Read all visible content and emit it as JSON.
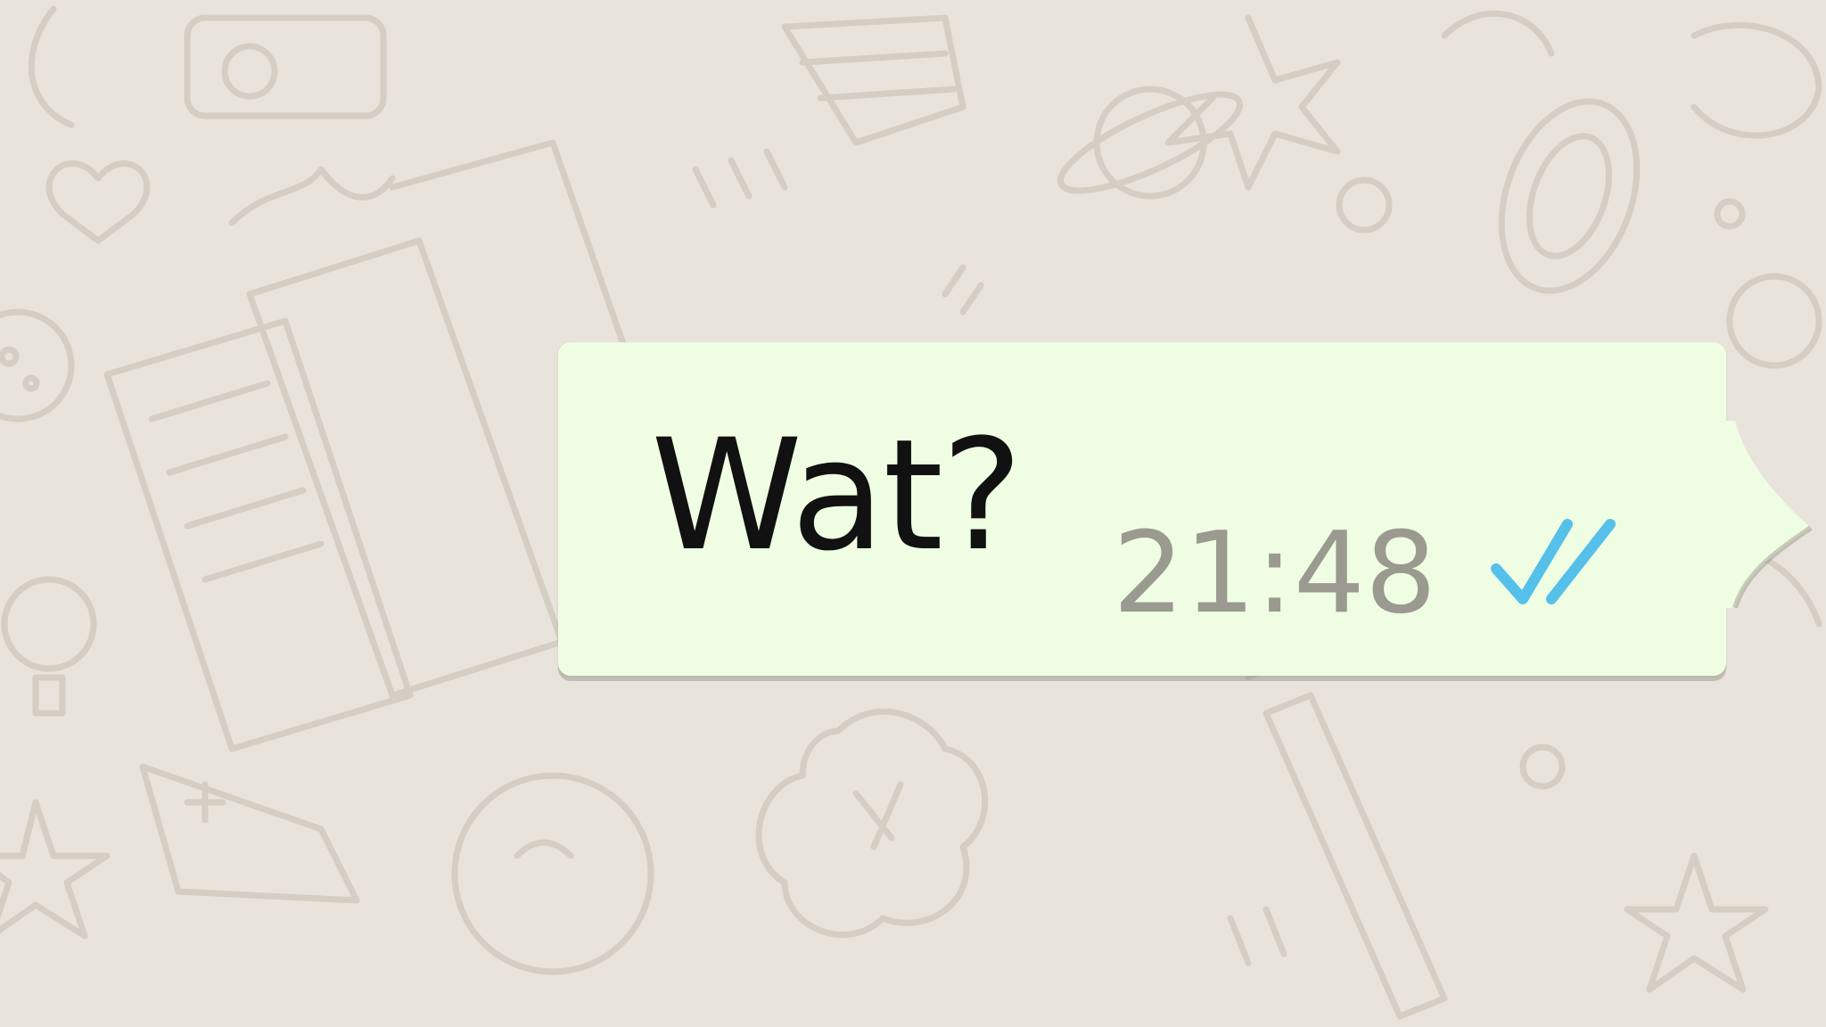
{
  "chat": {
    "wallpaper": "doodle-pattern",
    "background_color": "#e8e4dc",
    "doodle_color": "#cfc9be"
  },
  "message": {
    "direction": "outgoing",
    "text": "Wat?",
    "time": "21:48",
    "status": "read",
    "status_icon": "double-check-icon",
    "bubble_color": "#effee3",
    "tick_color": "#4fc3f7"
  }
}
